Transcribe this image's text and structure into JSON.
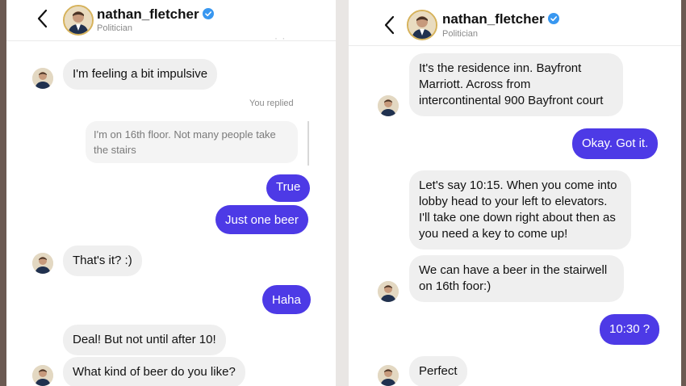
{
  "colors": {
    "outgoing_bubble": "#4d3ae6",
    "incoming_bubble": "#efefef",
    "verified_badge": "#3897f0"
  },
  "left": {
    "header": {
      "name": "nathan_fletcher",
      "subtitle": "Politician"
    },
    "messages": [
      {
        "dir": "in",
        "text": "I'm feeling a bit impulsive"
      },
      {
        "dir": "meta",
        "text": "You replied"
      },
      {
        "dir": "quote",
        "lines": [
          "I'm on 16th floor. Not many people take",
          "the stairs"
        ]
      },
      {
        "dir": "out",
        "text": "True"
      },
      {
        "dir": "out",
        "text": "Just one beer"
      },
      {
        "dir": "in",
        "text": "That's it? :)"
      },
      {
        "dir": "out",
        "text": "Haha"
      },
      {
        "dir": "in",
        "text": "Deal! But not until after 10!"
      },
      {
        "dir": "in",
        "text": "What kind of beer do you like?"
      }
    ]
  },
  "right": {
    "header": {
      "name": "nathan_fletcher",
      "subtitle": "Politician"
    },
    "messages": [
      {
        "dir": "in",
        "lines": [
          "It's the residence inn. Bayfront",
          "Marriott. Across from",
          "intercontinental 900 Bayfront court"
        ]
      },
      {
        "dir": "out",
        "text": "Okay. Got it."
      },
      {
        "dir": "in",
        "lines": [
          "Let's say 10:15. When you come into",
          "lobby head to your left to elevators.",
          "I'll take one down right about then as",
          "you need a key to come up!"
        ]
      },
      {
        "dir": "in",
        "lines": [
          "We can have a beer in the stairwell",
          "on 16th foor:)"
        ]
      },
      {
        "dir": "out",
        "text": "10:30 ?"
      },
      {
        "dir": "in",
        "text": "Perfect"
      }
    ]
  }
}
